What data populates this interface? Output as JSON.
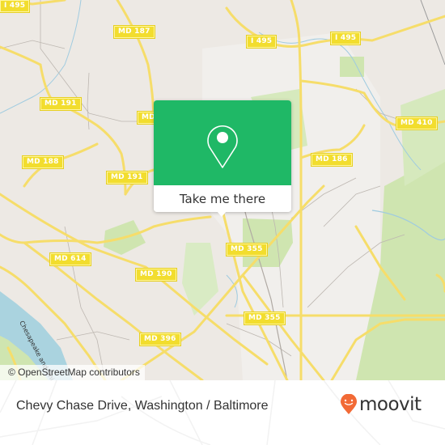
{
  "map": {
    "colors": {
      "land": "#ede9e4",
      "park": "#cfe5b0",
      "water": "#aad3df",
      "river_bank": "#a6d8ea",
      "road_major": "#f6dd6a",
      "road_minor": "#bdb7b1",
      "shield": "#f2dd2e"
    },
    "road_labels": [
      {
        "id": "i495-nw",
        "text": "I 495"
      },
      {
        "id": "md187",
        "text": "MD 187"
      },
      {
        "id": "i495-c",
        "text": "I 495"
      },
      {
        "id": "i495-e",
        "text": "I 495"
      },
      {
        "id": "md191-n",
        "text": "MD 191"
      },
      {
        "id": "md191-partial",
        "text": "MD"
      },
      {
        "id": "md410",
        "text": "MD 410"
      },
      {
        "id": "md188",
        "text": "MD 188"
      },
      {
        "id": "md186",
        "text": "MD 186"
      },
      {
        "id": "md191-s",
        "text": "MD 191"
      },
      {
        "id": "md355-n",
        "text": "MD 355"
      },
      {
        "id": "md614",
        "text": "MD 614"
      },
      {
        "id": "md190",
        "text": "MD 190"
      },
      {
        "id": "md355-s",
        "text": "MD 355"
      },
      {
        "id": "md396",
        "text": "MD 396"
      }
    ],
    "waterway_label": "Chesapeake and Ohio",
    "attribution": "© OpenStreetMap contributors"
  },
  "popup": {
    "icon": "map-pin-icon",
    "action_label": "Take me there",
    "color": "#1fb866"
  },
  "footer": {
    "title": "Chevy Chase Drive, Washington / Baltimore",
    "logo_text": "moovit",
    "logo_color": "#f26a36"
  }
}
